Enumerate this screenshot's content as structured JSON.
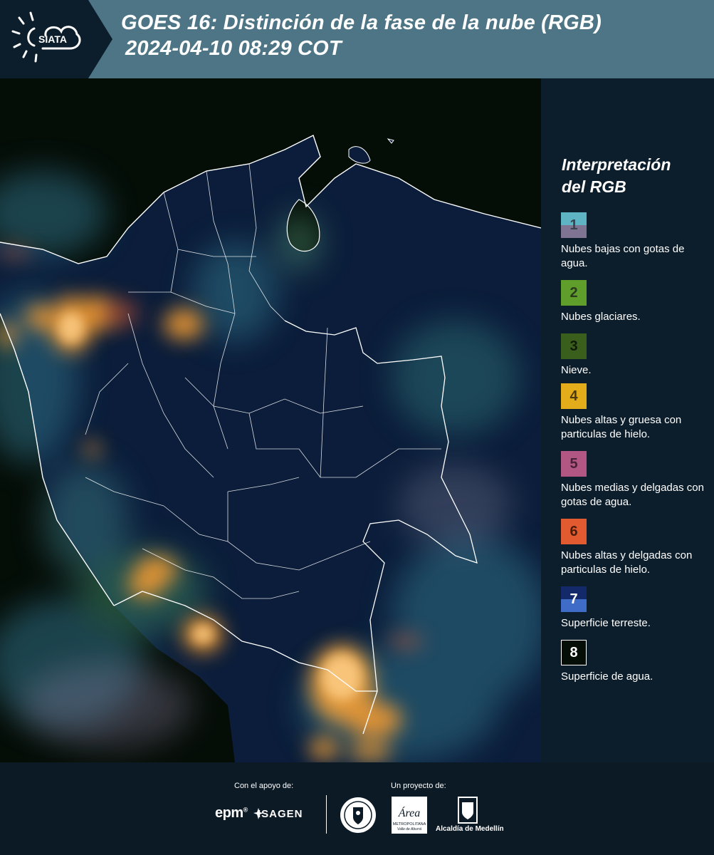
{
  "header": {
    "logo_text": "SIATA",
    "title_line1": "GOES 16: Distinción de la fase de la nube (RGB)",
    "title_line2": "2024-04-10 08:29 COT"
  },
  "legend": {
    "title": "Interpretación del RGB",
    "items": [
      {
        "num": "1",
        "label": "Nubes bajas con gotas de agua.",
        "color_top": "#5fb4c4",
        "color_bottom": "#7f7592",
        "text_color": "#3b4250"
      },
      {
        "num": "2",
        "label": "Nubes glaciares.",
        "color_top": "#5f9e2a",
        "color_bottom": "#5f9e2a",
        "text_color": "#2a3a20"
      },
      {
        "num": "3",
        "label": "Nieve.",
        "color_top": "#3a5f1d",
        "color_bottom": "#3a5f1d",
        "text_color": "#101a08"
      },
      {
        "num": "4",
        "label": "Nubes altas y gruesa con particulas de hielo.",
        "color_top": "#e2ac1b",
        "color_bottom": "#e2ac1b",
        "text_color": "#4a3a10"
      },
      {
        "num": "5",
        "label": "Nubes medias y delgadas con gotas de agua.",
        "color_top": "#b25684",
        "color_bottom": "#b25684",
        "text_color": "#4a2036"
      },
      {
        "num": "6",
        "label": "Nubes altas y delgadas con particulas de hielo.",
        "color_top": "#e25b30",
        "color_bottom": "#e25b30",
        "text_color": "#4a1c0c"
      },
      {
        "num": "7",
        "label": "Superficie terreste.",
        "color_top": "#13296a",
        "color_bottom": "#3f6cc6",
        "text_color": "#ffffff"
      },
      {
        "num": "8",
        "label": "Superficie de agua.",
        "color_top": "#050d07",
        "color_bottom": "#050d07",
        "text_color": "#ffffff",
        "border": "#ffffff"
      }
    ]
  },
  "footer": {
    "support_label": "Con el apoyo de:",
    "project_label": "Un proyecto de:",
    "epm": "epm",
    "epm_mark": "®",
    "isagen": "ISAGEN",
    "metro_line1": "Área",
    "metro_line2": "METROPOLITANA",
    "metro_line3": "Valle de Aburrá",
    "alcaldia": "Alcaldía de Medellín"
  },
  "colors": {
    "header_bg": "#4d7585",
    "logo_bg": "#0c1e2b",
    "sidebar_bg": "#0c1e2b",
    "footer_bg": "#0c1a26",
    "land": "#0b1d3a",
    "water": "#050d07",
    "cloud_high_thick": "#f6a238",
    "cloud_low": "#3b7f95",
    "border_line": "#ffffff"
  }
}
